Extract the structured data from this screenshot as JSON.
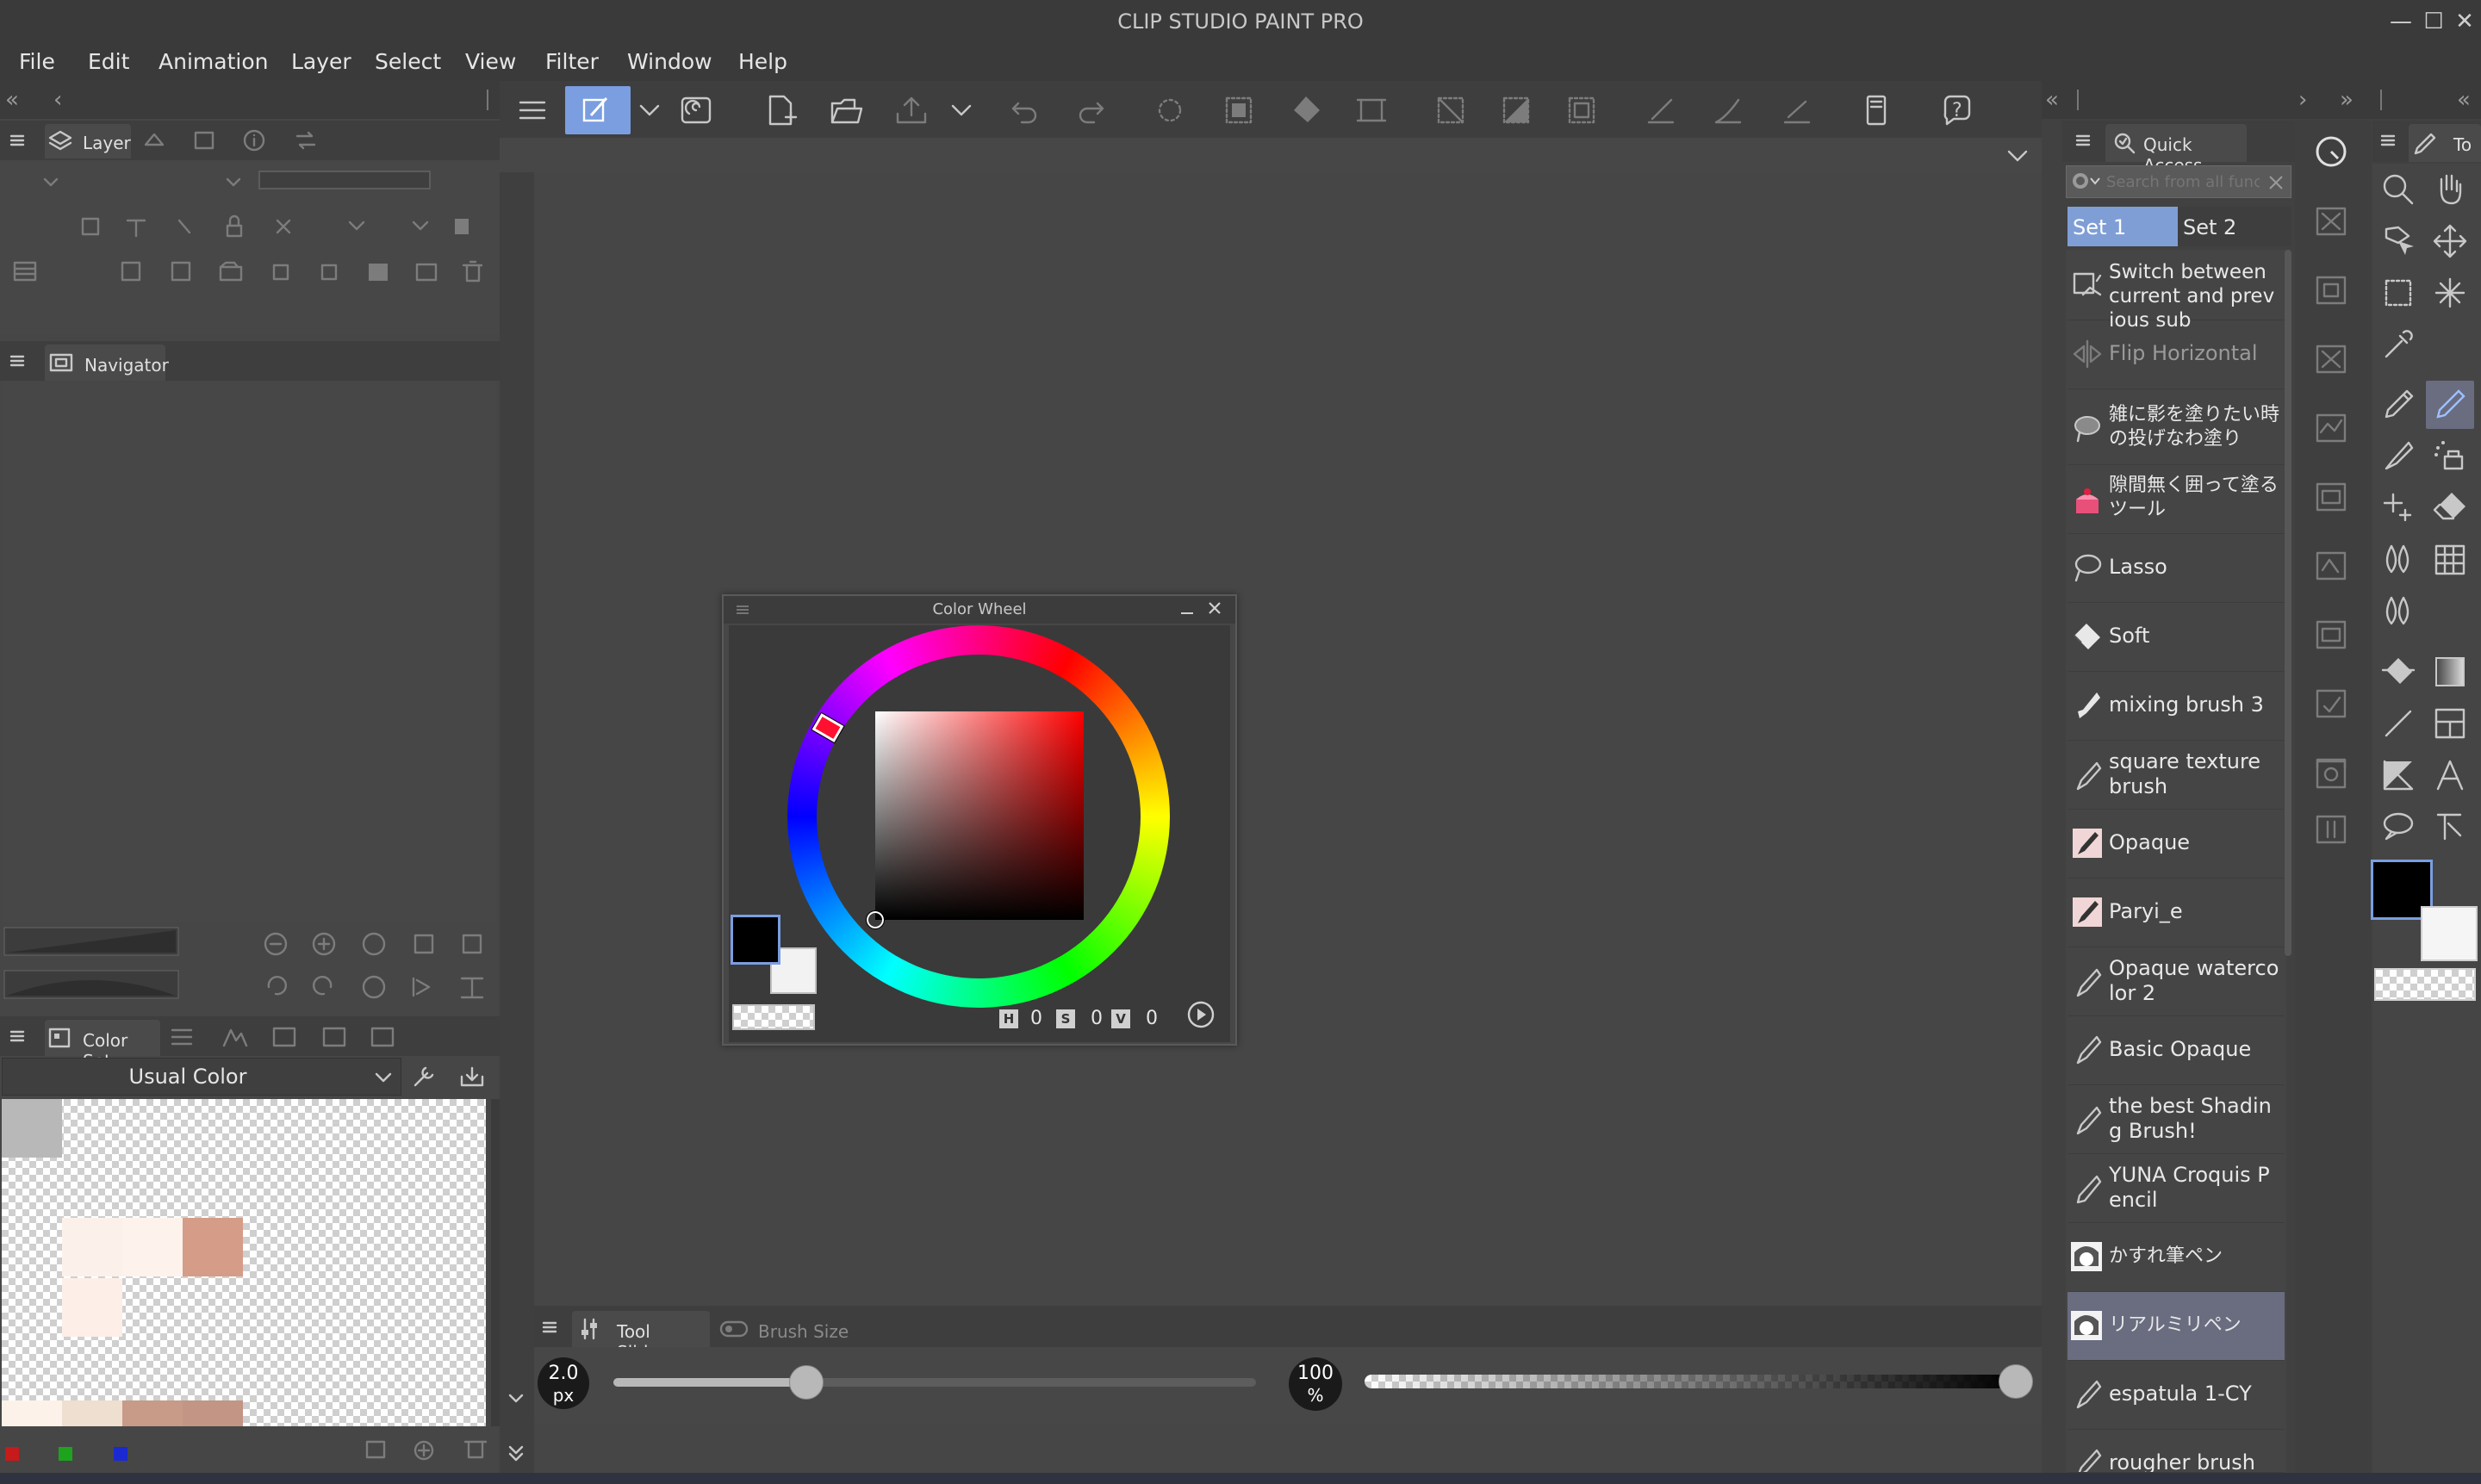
{
  "app": {
    "title": "CLIP STUDIO PAINT PRO"
  },
  "window_controls": {
    "minimize": "—",
    "maximize": "☐",
    "close": "✕"
  },
  "menu": [
    "File",
    "Edit",
    "Animation",
    "Layer",
    "Select",
    "View",
    "Filter",
    "Window",
    "Help"
  ],
  "layer_panel": {
    "tab_label": "Layer"
  },
  "navigator_panel": {
    "tab_label": "Navigator"
  },
  "color_set_panel": {
    "tab_label": "Color Set",
    "set_name": "Usual Color",
    "swatches": [
      "#b8b8b8",
      "#fbf1ea",
      "#fdf3ec",
      "#d59c88",
      "#fdeee8",
      "#fdf2ea",
      "#eedfd0",
      "#c89a88",
      "#c29584"
    ]
  },
  "color_wheel": {
    "title": "Color Wheel",
    "h_label": "H",
    "h_value": "0",
    "s_label": "S",
    "s_value": "0",
    "v_label": "V",
    "v_value": "0",
    "main_color": "#000000",
    "sub_color": "#f2f2f2"
  },
  "tool_sliders": {
    "tab_label": "Tool Sliders",
    "tab2_label": "Brush Size",
    "size_value": "2.0",
    "size_unit": "px",
    "size_fraction": 0.3,
    "opacity_value": "100",
    "opacity_unit": "%",
    "opacity_fraction": 1.0
  },
  "quick_access": {
    "tab_label": "Quick Access",
    "search_placeholder": "Search from all func",
    "sets": [
      "Set 1",
      "Set 2"
    ],
    "items": [
      {
        "label": "Switch between current and previous sub",
        "icon": "switch-icon"
      },
      {
        "label": "Flip Horizontal",
        "icon": "flip-horizontal-icon"
      },
      {
        "label": "雑に影を塗りたい時の投げなわ塗り",
        "icon": "lasso-fill-icon"
      },
      {
        "label": "隙間無く囲って塗るツール",
        "icon": "cake-icon"
      },
      {
        "label": "Lasso",
        "icon": "lasso-icon"
      },
      {
        "label": "Soft",
        "icon": "eraser-icon"
      },
      {
        "label": "mixing brush 3",
        "icon": "brush-icon"
      },
      {
        "label": "square texture brush",
        "icon": "brush-icon"
      },
      {
        "label": "Opaque",
        "icon": "opaque-icon"
      },
      {
        "label": "Paryi_e",
        "icon": "opaque-icon"
      },
      {
        "label": "Opaque watercolor 2",
        "icon": "brush-icon"
      },
      {
        "label": "Basic Opaque",
        "icon": "brush-icon"
      },
      {
        "label": "the best Shading Brush!",
        "icon": "brush-icon"
      },
      {
        "label": "YUNA Croquis Pencil",
        "icon": "pencil-icon"
      },
      {
        "label": "かすれ筆ペン",
        "icon": "avatar-icon"
      },
      {
        "label": "リアルミリペン",
        "icon": "avatar-icon"
      },
      {
        "label": "espatula 1-CY",
        "icon": "brush-icon"
      },
      {
        "label": "rougher brush",
        "icon": "brush-icon"
      }
    ]
  },
  "tool_panel": {
    "tab_label": "To",
    "main_color": "#000000",
    "sub_color": "#f5f5f5"
  },
  "colors": {
    "accent": "#7a9ee0",
    "selected_set": "#7f9ed6",
    "selected_item": "#6a6c80"
  }
}
